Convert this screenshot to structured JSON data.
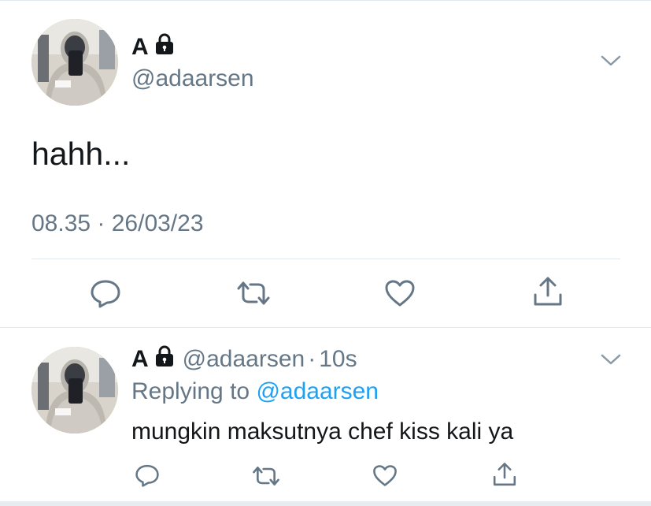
{
  "tweet": {
    "display_name": "A",
    "handle": "@adaarsen",
    "text": "hahh...",
    "timestamp": "08.35 · 26/03/23",
    "avatar_icon": "avatar-photo",
    "lock_icon": "lock-icon",
    "more_icon": "chevron-down-icon",
    "actions": [
      "reply-icon",
      "retweet-icon",
      "like-icon",
      "share-icon"
    ]
  },
  "reply": {
    "display_name": "A",
    "handle": "@adaarsen",
    "separator": "·",
    "time_ago": "10s",
    "replying_prefix": "Replying to",
    "replying_handle": "@adaarsen",
    "text": "mungkin maksutnya chef kiss kali ya",
    "actions": [
      "reply-icon",
      "retweet-icon",
      "like-icon",
      "share-icon"
    ]
  },
  "colors": {
    "text": "#14171a",
    "secondary": "#657786",
    "link": "#1da1f2",
    "divider": "#e1e8ed"
  }
}
